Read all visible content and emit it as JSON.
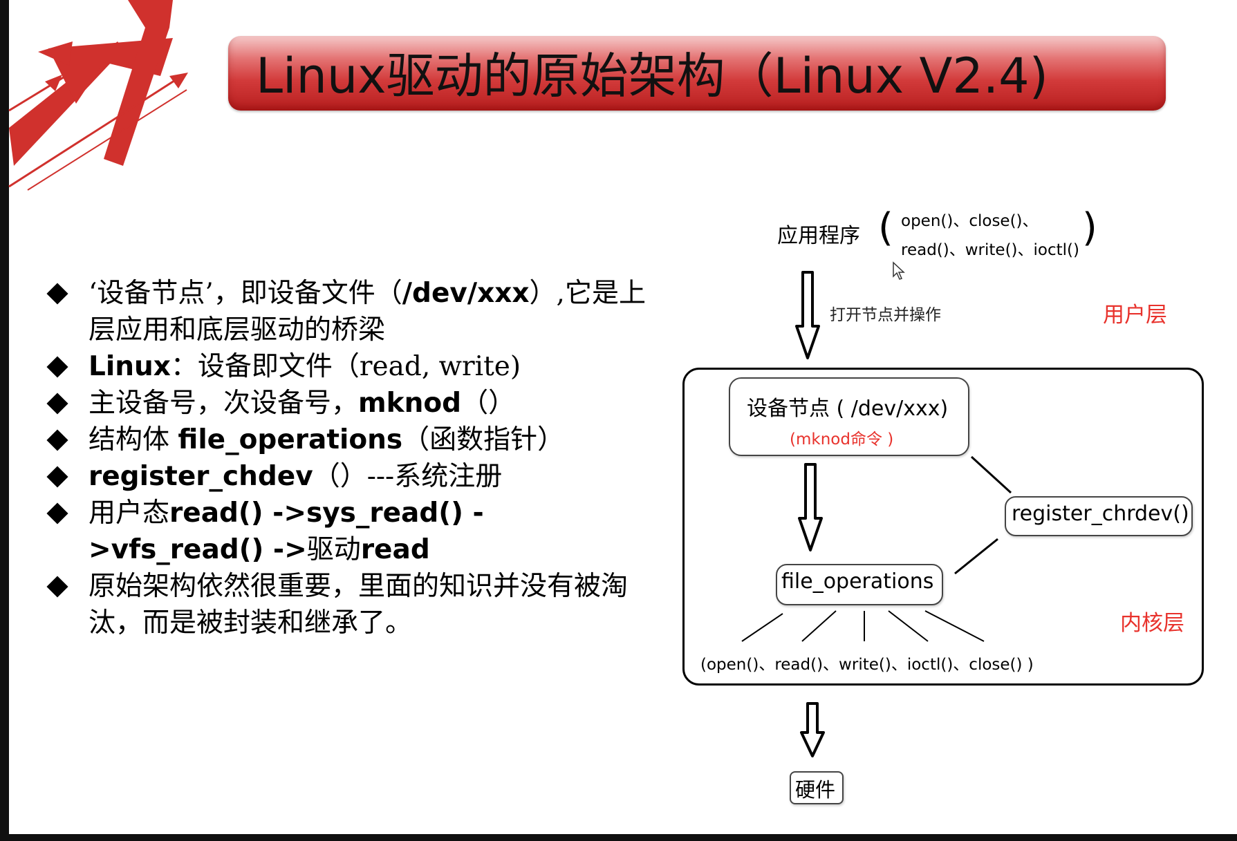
{
  "title": "Linux驱动的原始架构（Linux V2.4)",
  "bullets": [
    {
      "pre": "‘设备节点’，即设备文件（",
      "bold": "/dev/xxx",
      "post": "）,它是上层应用和底层驱动的桥梁"
    },
    {
      "bold": "Linux",
      "post": "：设备即文件（read, write)"
    },
    {
      "pre": "主设备号，次设备号，",
      "bold": "mknod",
      "post": "（）"
    },
    {
      "pre": "结构体 ",
      "bold": "file_operations",
      "post": "（函数指针）"
    },
    {
      "bold": "register_chdev",
      "post": "（）---系统注册"
    },
    {
      "pre": "用户态",
      "bold": "read() ->sys_read() ->vfs_read() ->",
      "post": "驱动",
      "bold2": "read"
    },
    {
      "pre": "原始架构依然很重要，里面的知识并没有被淘汰，而是被封装和继承了。"
    }
  ],
  "diagram": {
    "app_label": "应用程序",
    "app_funcs_line1": "open()、close()、",
    "app_funcs_line2": "read()、write()、ioctl()",
    "open_node_label": "打开节点并操作",
    "user_layer_label": "用户层",
    "device_node_label": "设备节点 ( /dev/xxx)",
    "mknod_label": "(mknod命令 )",
    "register_label": "register_chrdev()",
    "file_ops_label": "file_operations",
    "kernel_layer_label": "内核层",
    "ops_list": "(open()、read()、write()、ioctl()、close() )",
    "hardware_label": "硬件"
  },
  "colors": {
    "accent_red": "#d0312d",
    "layer_label_red": "#e8322c"
  }
}
